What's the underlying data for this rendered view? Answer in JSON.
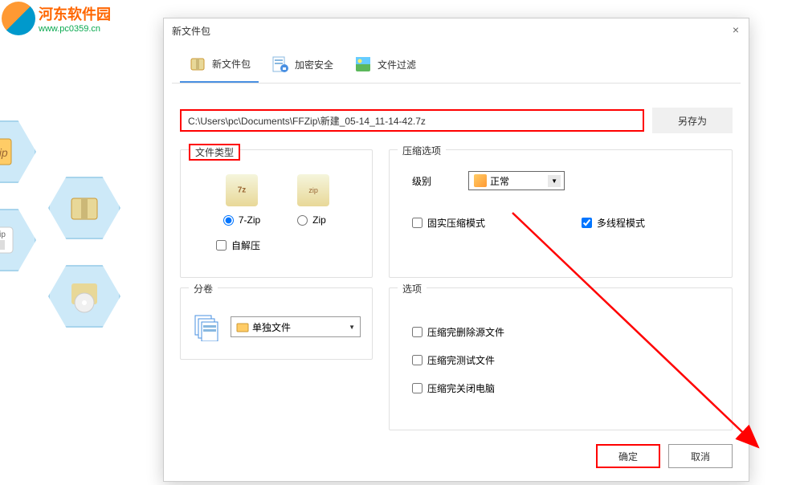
{
  "watermark": {
    "title": "河东软件园",
    "url": "www.pc0359.cn"
  },
  "dialog": {
    "title": "新文件包",
    "close": "×"
  },
  "tabs": {
    "new_package": "新文件包",
    "encrypt": "加密安全",
    "filter": "文件过滤"
  },
  "path": {
    "value": "C:\\Users\\pc\\Documents\\FFZip\\新建_05-14_11-14-42.7z",
    "save_as": "另存为"
  },
  "file_type": {
    "label": "文件类型",
    "type_7zip": "7-Zip",
    "type_zip": "Zip",
    "self_extract": "自解压"
  },
  "volume": {
    "label": "分卷",
    "selected": "单独文件"
  },
  "compress_options": {
    "label": "压缩选项",
    "level_label": "级别",
    "level_value": "正常",
    "solid_mode": "固实压缩模式",
    "multithread": "多线程模式"
  },
  "options": {
    "label": "选项",
    "delete_source": "压缩完删除源文件",
    "test_file": "压缩完测试文件",
    "shutdown": "压缩完关闭电脑"
  },
  "buttons": {
    "ok": "确定",
    "cancel": "取消"
  }
}
